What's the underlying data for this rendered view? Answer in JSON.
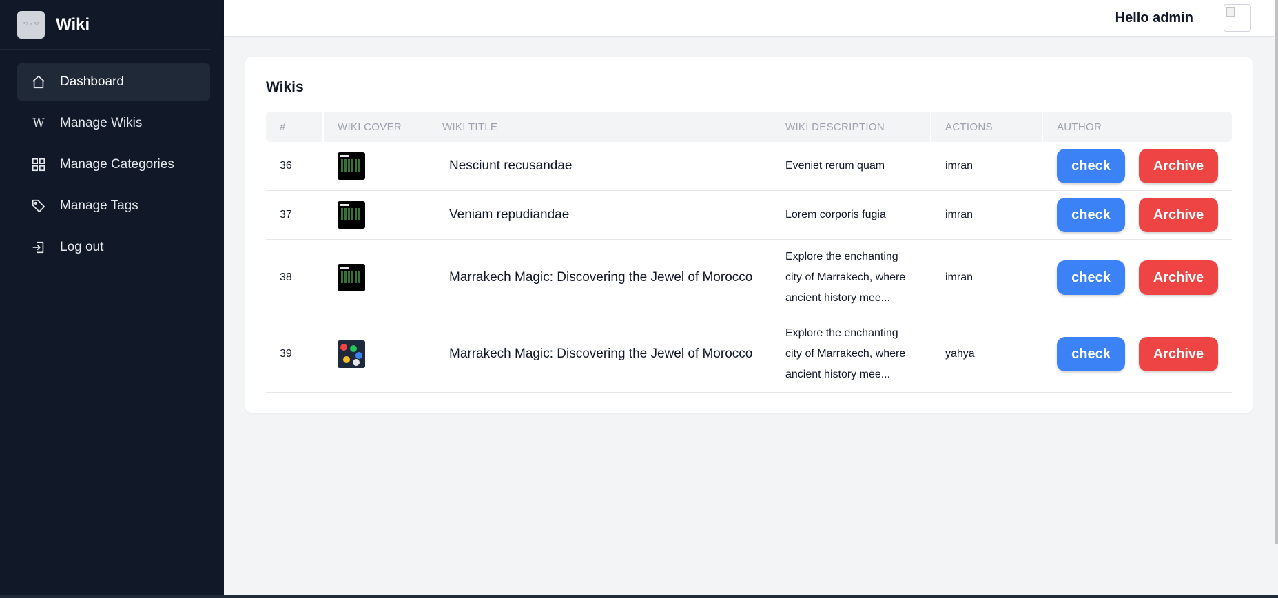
{
  "sidebar": {
    "logo_placeholder": "32 × 32",
    "brand": "Wiki",
    "items": [
      {
        "label": "Dashboard",
        "icon": "home-icon",
        "active": true
      },
      {
        "label": "Manage Wikis",
        "icon": "w-icon",
        "active": false
      },
      {
        "label": "Manage Categories",
        "icon": "grid-icon",
        "active": false
      },
      {
        "label": "Manage Tags",
        "icon": "tag-icon",
        "active": false
      },
      {
        "label": "Log out",
        "icon": "logout-icon",
        "active": false
      }
    ]
  },
  "header": {
    "greeting": "Hello admin"
  },
  "main": {
    "title": "Wikis",
    "columns": [
      "#",
      "WIKI COVER",
      "WIKI TITLE",
      "WIKI DESCRIPTION",
      "ACTIONS",
      "AUTHOR"
    ],
    "rows": [
      {
        "id": "36",
        "title": "Nesciunt recusandae",
        "description": "Eveniet rerum quam",
        "author": "imran",
        "check": "check",
        "archive": "Archive"
      },
      {
        "id": "37",
        "title": "Veniam repudiandae",
        "description": "Lorem corporis fugia",
        "author": "imran",
        "check": "check",
        "archive": "Archive"
      },
      {
        "id": "38",
        "title": "Marrakech Magic: Discovering the Jewel of Morocco",
        "description": "Explore the enchanting city of Marrakech, where ancient history mee...",
        "author": "imran",
        "check": "check",
        "archive": "Archive"
      },
      {
        "id": "39",
        "title": "Marrakech Magic: Discovering the Jewel of Morocco",
        "description": "Explore the enchanting city of Marrakech, where ancient history mee...",
        "author": "yahya",
        "check": "check",
        "archive": "Archive"
      }
    ]
  },
  "colors": {
    "sidebar_bg": "#111827",
    "check_button": "#3b82f6",
    "archive_button": "#ef4444"
  }
}
